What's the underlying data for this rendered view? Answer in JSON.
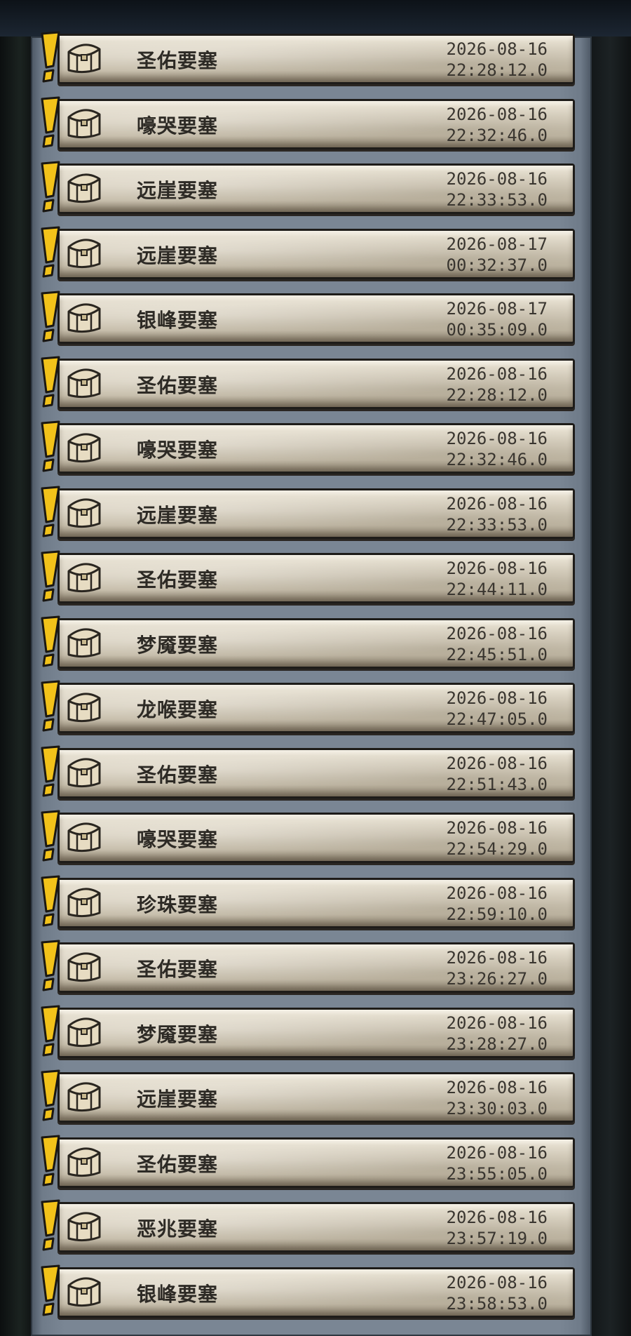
{
  "mails": [
    {
      "name": "圣佑要塞",
      "date": "2026-08-16",
      "time": "22:28:12.0"
    },
    {
      "name": "嚎哭要塞",
      "date": "2026-08-16",
      "time": "22:32:46.0"
    },
    {
      "name": "远崖要塞",
      "date": "2026-08-16",
      "time": "22:33:53.0"
    },
    {
      "name": "远崖要塞",
      "date": "2026-08-17",
      "time": "00:32:37.0"
    },
    {
      "name": "银峰要塞",
      "date": "2026-08-17",
      "time": "00:35:09.0"
    },
    {
      "name": "圣佑要塞",
      "date": "2026-08-16",
      "time": "22:28:12.0"
    },
    {
      "name": "嚎哭要塞",
      "date": "2026-08-16",
      "time": "22:32:46.0"
    },
    {
      "name": "远崖要塞",
      "date": "2026-08-16",
      "time": "22:33:53.0"
    },
    {
      "name": "圣佑要塞",
      "date": "2026-08-16",
      "time": "22:44:11.0"
    },
    {
      "name": "梦魇要塞",
      "date": "2026-08-16",
      "time": "22:45:51.0"
    },
    {
      "name": "龙喉要塞",
      "date": "2026-08-16",
      "time": "22:47:05.0"
    },
    {
      "name": "圣佑要塞",
      "date": "2026-08-16",
      "time": "22:51:43.0"
    },
    {
      "name": "嚎哭要塞",
      "date": "2026-08-16",
      "time": "22:54:29.0"
    },
    {
      "name": "珍珠要塞",
      "date": "2026-08-16",
      "time": "22:59:10.0"
    },
    {
      "name": "圣佑要塞",
      "date": "2026-08-16",
      "time": "23:26:27.0"
    },
    {
      "name": "梦魇要塞",
      "date": "2026-08-16",
      "time": "23:28:27.0"
    },
    {
      "name": "远崖要塞",
      "date": "2026-08-16",
      "time": "23:30:03.0"
    },
    {
      "name": "圣佑要塞",
      "date": "2026-08-16",
      "time": "23:55:05.0"
    },
    {
      "name": "恶兆要塞",
      "date": "2026-08-16",
      "time": "23:57:19.0"
    },
    {
      "name": "银峰要塞",
      "date": "2026-08-16",
      "time": "23:58:53.0"
    }
  ],
  "colors": {
    "alert": "#f2c21a",
    "parchment": "#d8d0bf",
    "panel": "#7a8694"
  },
  "icons": {
    "alert": "exclamation-alert-icon",
    "chest": "treasure-chest-icon"
  }
}
